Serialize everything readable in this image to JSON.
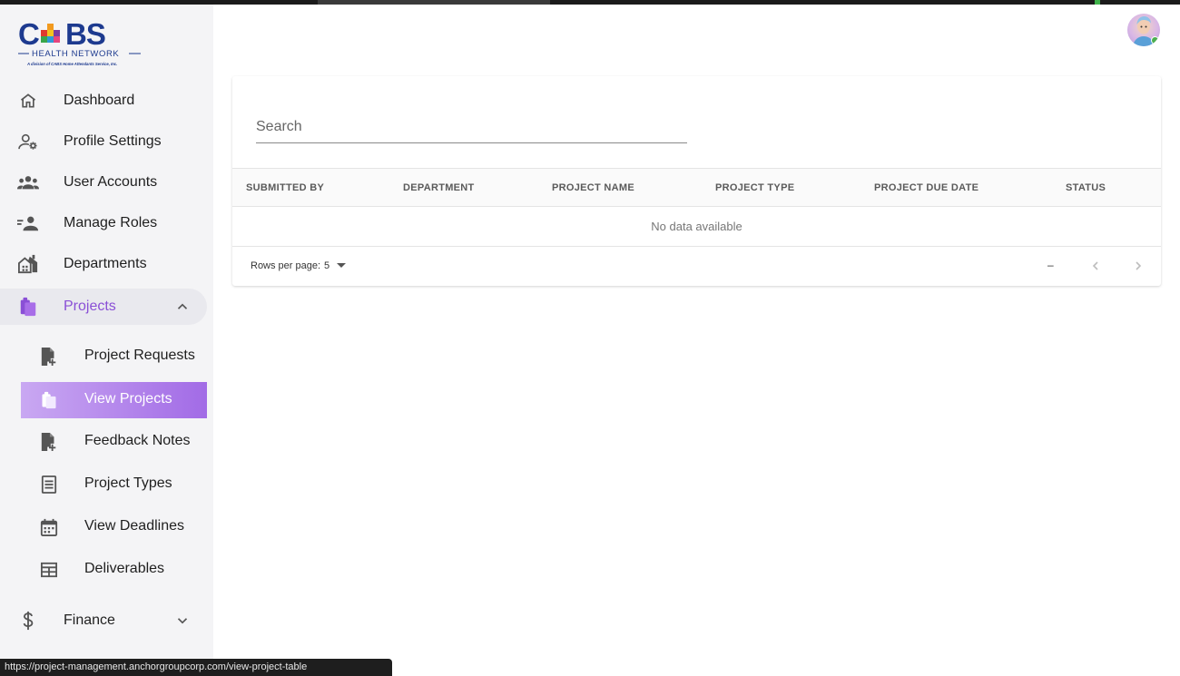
{
  "brand": {
    "logo_text": "CABS",
    "logo_subtitle": "HEALTH NETWORK",
    "logo_tagline": "A division of CABS Home Attendants Service, Inc.",
    "accent_color": "#8a4fd6"
  },
  "sidebar": {
    "items": [
      {
        "label": "Dashboard",
        "icon": "home-icon"
      },
      {
        "label": "Profile Settings",
        "icon": "user-settings-icon"
      },
      {
        "label": "User Accounts",
        "icon": "users-group-icon"
      },
      {
        "label": "Manage Roles",
        "icon": "user-roles-icon"
      },
      {
        "label": "Departments",
        "icon": "departments-icon"
      },
      {
        "label": "Projects",
        "icon": "projects-icon",
        "expanded": true
      },
      {
        "label": "Finance",
        "icon": "dollar-icon",
        "expanded": false
      }
    ],
    "projects_sub": [
      {
        "label": "Project Requests",
        "icon": "file-add-icon"
      },
      {
        "label": "View Projects",
        "icon": "projects-icon",
        "active": true
      },
      {
        "label": "Feedback Notes",
        "icon": "file-add-icon"
      },
      {
        "label": "Project Types",
        "icon": "list-icon"
      },
      {
        "label": "View Deadlines",
        "icon": "calendar-icon"
      },
      {
        "label": "Deliverables",
        "icon": "table-icon"
      }
    ]
  },
  "search": {
    "placeholder": "Search",
    "value": ""
  },
  "table": {
    "columns": [
      "SUBMITTED BY",
      "DEPARTMENT",
      "PROJECT NAME",
      "PROJECT TYPE",
      "PROJECT DUE DATE",
      "STATUS"
    ],
    "rows": [],
    "empty_text": "No data available"
  },
  "pagination": {
    "rows_per_page_label": "Rows per page:",
    "rows_per_page_value": "5",
    "range_text": "–"
  },
  "status_bar": {
    "url": "https://project-management.anchorgroupcorp.com/view-project-table"
  }
}
